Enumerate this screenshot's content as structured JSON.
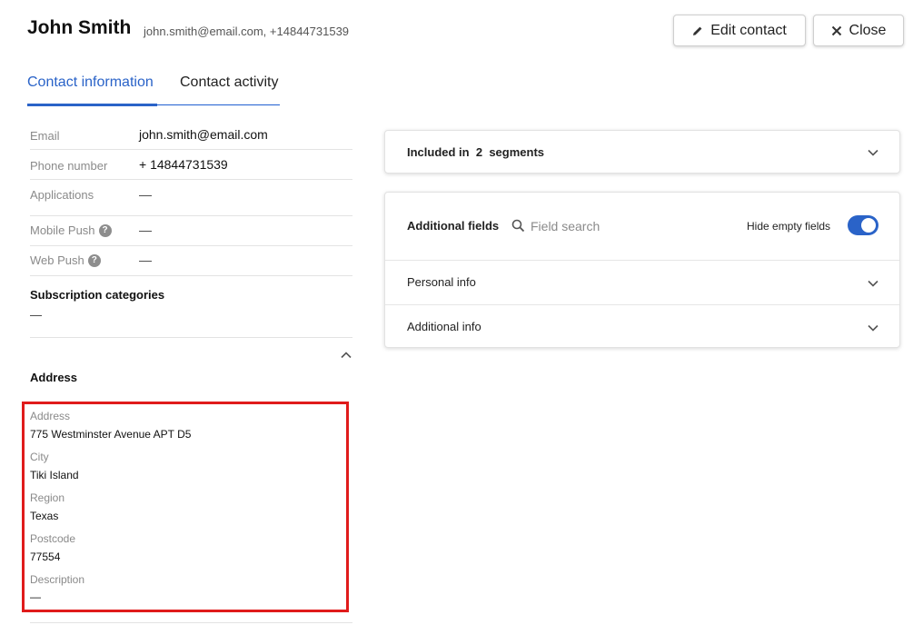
{
  "header": {
    "name": "John Smith",
    "subtitle": "john.smith@email.com, +14844731539",
    "edit_label": "Edit contact",
    "close_label": "Close"
  },
  "tabs": [
    {
      "label": "Contact information",
      "active": true
    },
    {
      "label": "Contact activity",
      "active": false
    }
  ],
  "contact": {
    "email_label": "Email",
    "email_value": "john.smith@email.com",
    "phone_label": "Phone number",
    "phone_value": "+ 14844731539",
    "applications_label": "Applications",
    "applications_value": "—",
    "mobile_push_label": "Mobile Push",
    "mobile_push_value": "—",
    "web_push_label": "Web Push",
    "web_push_value": "—"
  },
  "subscription": {
    "title": "Subscription categories",
    "value": "—"
  },
  "address": {
    "title": "Address",
    "fields": [
      {
        "label": "Address",
        "value": "775 Westminster Avenue APT D5"
      },
      {
        "label": "City",
        "value": "Tiki Island"
      },
      {
        "label": "Region",
        "value": "Texas"
      },
      {
        "label": "Postcode",
        "value": "77554"
      },
      {
        "label": "Description",
        "value": "—"
      }
    ]
  },
  "segments": {
    "prefix": "Included in",
    "count": "2",
    "suffix": "segments"
  },
  "additional_fields": {
    "title": "Additional fields",
    "search_placeholder": "Field search",
    "hide_empty_label": "Hide empty fields",
    "hide_empty_on": true,
    "sections": [
      {
        "label": "Personal info"
      },
      {
        "label": "Additional info"
      }
    ]
  },
  "colors": {
    "accent": "#2a63c8",
    "highlight": "#e01b1b"
  }
}
